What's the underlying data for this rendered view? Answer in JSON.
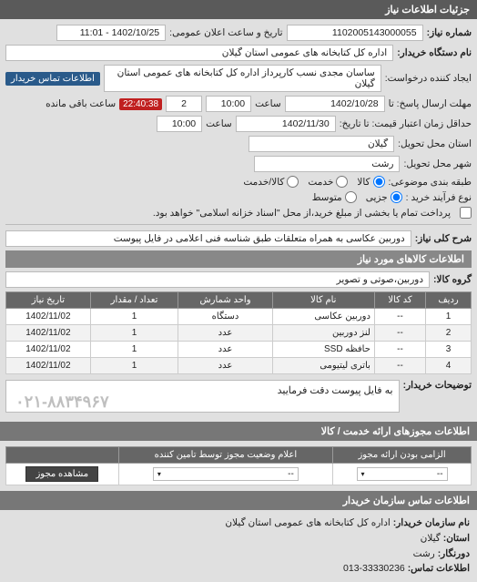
{
  "headers": {
    "main": "جزئیات اطلاعات نیاز",
    "goods_info": "اطلاعات کالاهای مورد نیاز",
    "service_permits": "اطلاعات مجوزهای ارائه خدمت / کالا",
    "buyer_contact": "اطلاعات تماس سازمان خریدار"
  },
  "labels": {
    "ref_no": "شماره نیاز:",
    "announce_dt": "تاریخ و ساعت اعلان عمومی:",
    "buyer_org": "نام دستگاه خریدار:",
    "requester": "ایجاد کننده درخواست:",
    "buyer_contact_link": "اطلاعات تماس خریدار",
    "reply_deadline": "مهلت ارسال پاسخ: تا",
    "time": "ساعت",
    "countdown_suffix": "ساعت باقی مانده",
    "price_validity": "حداقل زمان اعتبار قیمت: تا تاریخ:",
    "province": "استان محل تحویل:",
    "city": "شهر محل تحویل:",
    "classification": "طبقه بندی موضوعی:",
    "proc_type": "نوع فرآیند خرید :",
    "proc_note": "پرداخت تمام یا بخشی از مبلغ خرید،از محل \"اسناد خزانه اسلامی\" خواهد بود.",
    "need_desc": "شرح کلی نیاز:",
    "goods_group": "گروه کالا:",
    "buyer_notes": "توضیحات خریدار:",
    "stamp_phone": "۰۲۱-۸۸۳۴۹۶۷",
    "org_name_lbl": "نام سازمان خریدار:",
    "province_lbl": "استان:",
    "city_lbl": "دورنگار:",
    "contact_lbl": "اطلاعات تماس:"
  },
  "values": {
    "ref_no": "1102005143000055",
    "announce_dt": "1402/10/25 - 11:01",
    "buyer_org": "اداره کل کتابخانه های عمومی استان گیلان",
    "requester": "ساسان مجدی نسب کارپرداز اداره کل کتابخانه های عمومی استان گیلان",
    "reply_date": "1402/10/28",
    "reply_time": "10:00",
    "days_left": "2",
    "countdown": "22:40:38",
    "price_date": "1402/11/30",
    "price_time": "10:00",
    "province": "گیلان",
    "city": "رشت",
    "need_desc": "دوربین عکاسی به همراه متعلقات طبق شناسه فنی اعلامی در فایل پیوست",
    "goods_group": "دوربین،صوتی و تصویر",
    "buyer_notes": "به فایل پیوست دقت فرمایید",
    "org_name": "اداره کل کتابخانه های عمومی استان گیلان",
    "org_province": "گیلان",
    "org_city": "رشت",
    "org_contact": "33330236-013"
  },
  "radios": {
    "class_opts": [
      "کالا",
      "خدمت",
      "کالا/خدمت"
    ],
    "class_selected": 0,
    "proc_opts": [
      "جزیی",
      "متوسط"
    ],
    "proc_selected": 0
  },
  "goods_table": {
    "cols": [
      "ردیف",
      "کد کالا",
      "نام کالا",
      "واحد شمارش",
      "تعداد / مقدار",
      "تاریخ نیاز"
    ],
    "rows": [
      [
        "1",
        "--",
        "دوربین عکاسی",
        "دستگاه",
        "1",
        "1402/11/02"
      ],
      [
        "2",
        "--",
        "لنز دوربین",
        "عدد",
        "1",
        "1402/11/02"
      ],
      [
        "3",
        "--",
        "حافظه SSD",
        "عدد",
        "1",
        "1402/11/02"
      ],
      [
        "4",
        "--",
        "باتری لیتیومی",
        "عدد",
        "1",
        "1402/11/02"
      ]
    ]
  },
  "permit_table": {
    "cols": [
      "الزامی بودن ارائه مجوز",
      "اعلام وضعیت مجوز توسط تامین کننده",
      ""
    ],
    "select_placeholder": "--",
    "view_btn": "مشاهده مجوز"
  }
}
